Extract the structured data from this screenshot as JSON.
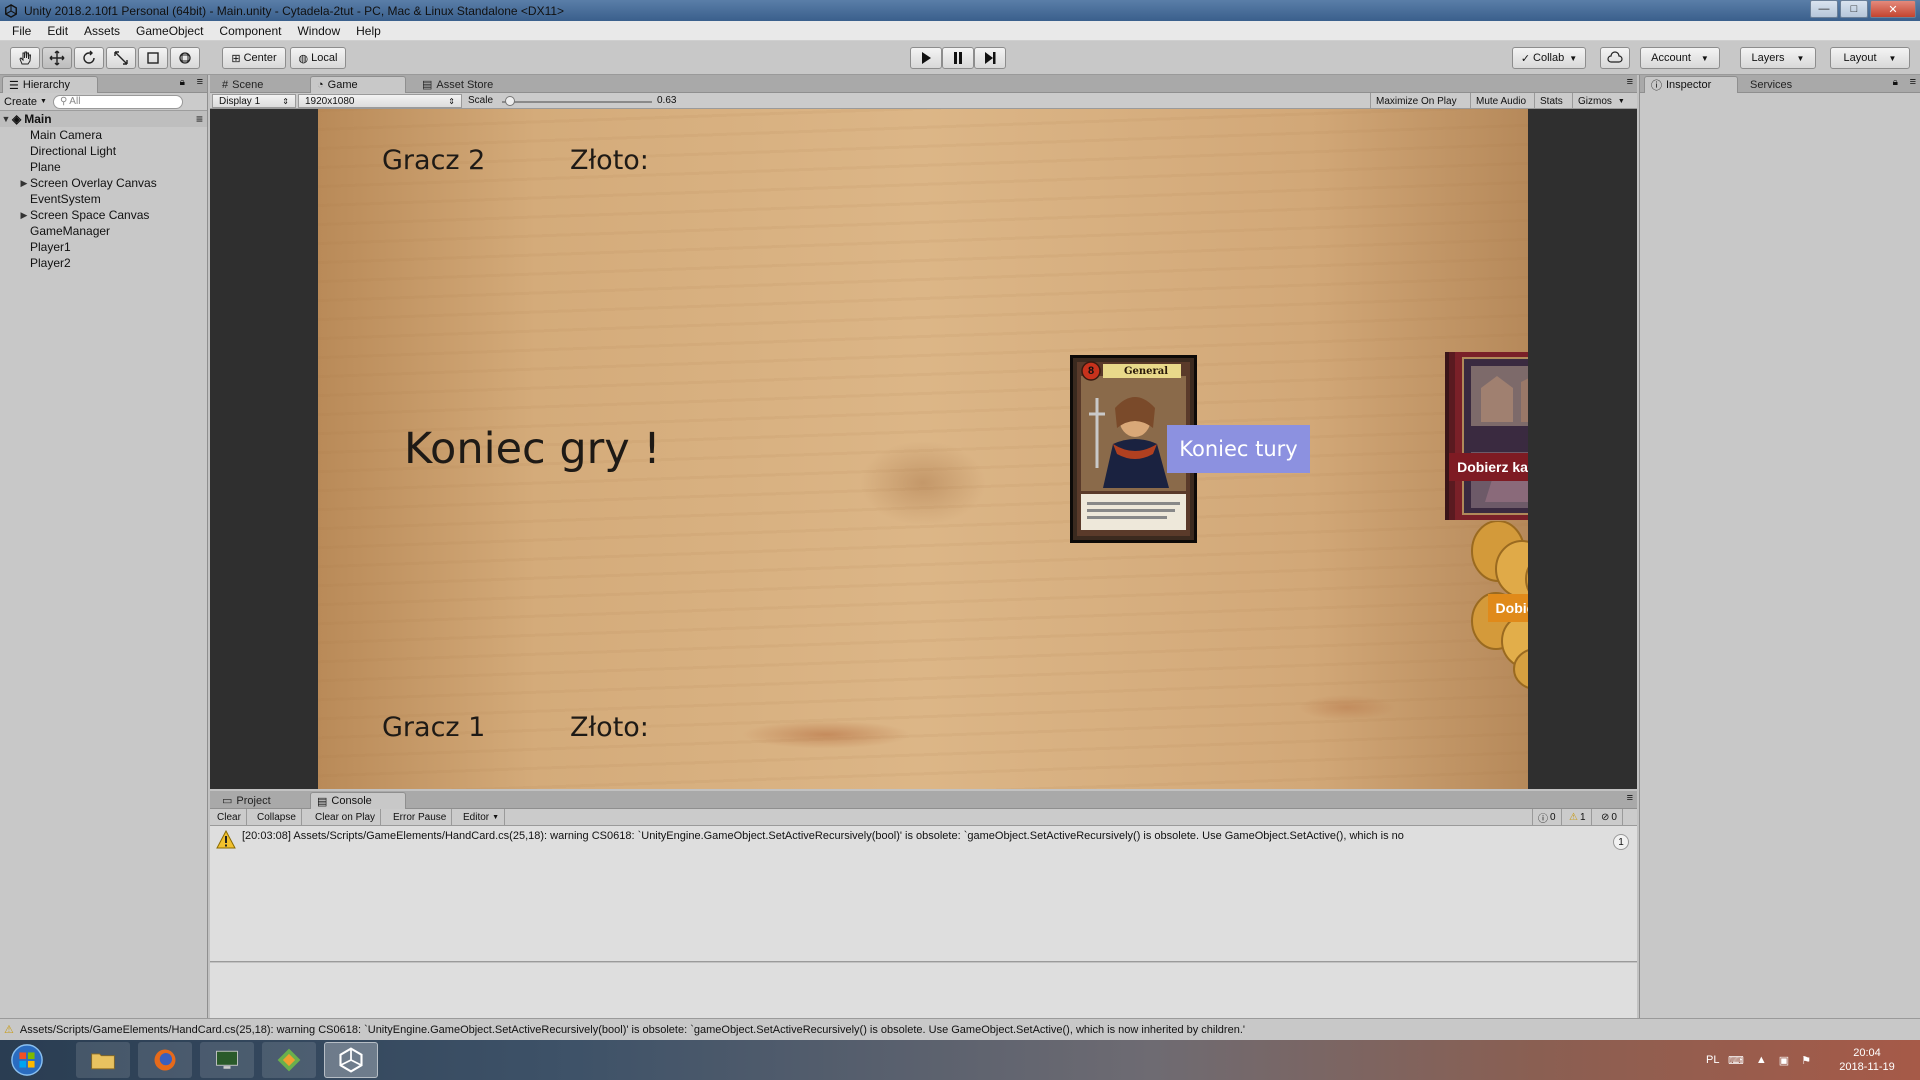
{
  "window": {
    "title": "Unity 2018.2.10f1 Personal (64bit) - Main.unity - Cytadela-2tut - PC, Mac & Linux Standalone <DX11>",
    "min_label": "—",
    "max_label": "□",
    "close_label": "✕"
  },
  "menu": [
    "File",
    "Edit",
    "Assets",
    "GameObject",
    "Component",
    "Window",
    "Help"
  ],
  "toolbar": {
    "center_label": "Center",
    "local_label": "Local",
    "collab_label": "Collab",
    "account_label": "Account",
    "layers_label": "Layers",
    "layout_label": "Layout"
  },
  "hierarchy": {
    "tab_label": "Hierarchy",
    "create_label": "Create",
    "search_placeholder": "All",
    "scene_name": "Main",
    "items": [
      {
        "label": "Main Camera"
      },
      {
        "label": "Directional Light"
      },
      {
        "label": "Plane"
      },
      {
        "label": "Screen Overlay Canvas"
      },
      {
        "label": "EventSystem"
      },
      {
        "label": "Screen Space Canvas"
      },
      {
        "label": "GameManager"
      },
      {
        "label": "Player1"
      },
      {
        "label": "Player2"
      }
    ]
  },
  "center_tabs": {
    "scene": "Scene",
    "game": "Game",
    "asset_store": "Asset Store"
  },
  "game_bar": {
    "display": "Display 1",
    "resolution": "1920x1080",
    "scale_label": "Scale",
    "scale_value": "0.63",
    "scale_fraction": 0.02,
    "maximize": "Maximize On Play",
    "mute": "Mute Audio",
    "stats": "Stats",
    "gizmos": "Gizmos"
  },
  "game": {
    "player2": "Gracz 2",
    "player1": "Gracz 1",
    "gold_label_top": "Złoto:",
    "gold_label_bottom": "Złoto:",
    "game_over": "Koniec gry !",
    "end_turn": "Koniec tury",
    "draw_card": "Dobierz karte",
    "draw_gold": "Dobierz zloto",
    "card_name": "General",
    "card_cost": "8"
  },
  "right_panel": {
    "inspector": "Inspector",
    "services": "Services"
  },
  "console": {
    "project_tab": "Project",
    "console_tab": "Console",
    "clear": "Clear",
    "collapse": "Collapse",
    "clear_on_play": "Clear on Play",
    "error_pause": "Error Pause",
    "editor": "Editor",
    "info_count": "0",
    "warn_count": "1",
    "error_count": "0",
    "message": "[20:03:08] Assets/Scripts/GameElements/HandCard.cs(25,18): warning CS0618: `UnityEngine.GameObject.SetActiveRecursively(bool)' is obsolete: `gameObject.SetActiveRecursively() is obsolete. Use GameObject.SetActive(), which is no",
    "message_count": "1"
  },
  "status": {
    "message": "Assets/Scripts/GameElements/HandCard.cs(25,18): warning CS0618: `UnityEngine.GameObject.SetActiveRecursively(bool)' is obsolete: `gameObject.SetActiveRecursively() is obsolete. Use GameObject.SetActive(), which is now inherited by children.'"
  },
  "taskbar": {
    "lang": "PL",
    "time": "20:04",
    "date": "2018-11-19"
  },
  "colors": {
    "end_turn_bg": "#8c91e0",
    "draw_card_bg": "#7e1b23",
    "draw_gold_bg": "#e08a1a",
    "warning": "#f2c12e"
  }
}
